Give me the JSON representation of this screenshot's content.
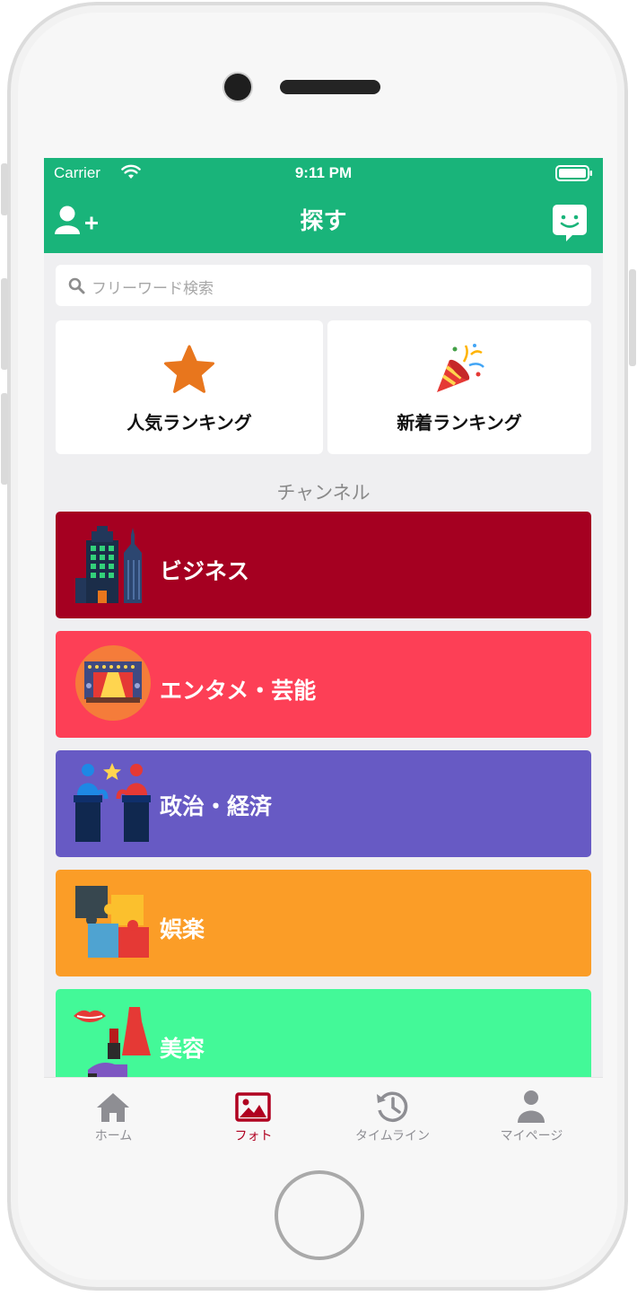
{
  "status_bar": {
    "carrier": "Carrier",
    "time": "9:11 PM"
  },
  "nav": {
    "title": "探す",
    "left_icon": "add-user-icon",
    "right_icon": "chat-face-icon"
  },
  "search": {
    "placeholder": "フリーワード検索",
    "icon": "search-icon"
  },
  "rankings": [
    {
      "label": "人気ランキング",
      "icon": "star-icon",
      "color": "#e8761d"
    },
    {
      "label": "新着ランキング",
      "icon": "party-popper-icon",
      "color": "#e53935"
    }
  ],
  "section_title": "チャンネル",
  "channels": [
    {
      "label": "ビジネス",
      "icon": "buildings-icon",
      "color": "#a50021"
    },
    {
      "label": "エンタメ・芸能",
      "icon": "stage-icon",
      "color": "#fd3f56"
    },
    {
      "label": "政治・経済",
      "icon": "podium-icon",
      "color": "#675ac4"
    },
    {
      "label": "娯楽",
      "icon": "puzzle-icon",
      "color": "#fb9d27"
    },
    {
      "label": "美容",
      "icon": "cosmetics-icon",
      "color": "#43f998"
    }
  ],
  "tabs": [
    {
      "label": "ホーム",
      "icon": "home-icon",
      "active": false
    },
    {
      "label": "フォト",
      "icon": "photo-icon",
      "active": true
    },
    {
      "label": "タイムライン",
      "icon": "history-icon",
      "active": false
    },
    {
      "label": "マイページ",
      "icon": "person-icon",
      "active": false
    }
  ],
  "colors": {
    "header": "#19b47a",
    "active_tab": "#b00020",
    "inactive_tab": "#8e8e93"
  }
}
